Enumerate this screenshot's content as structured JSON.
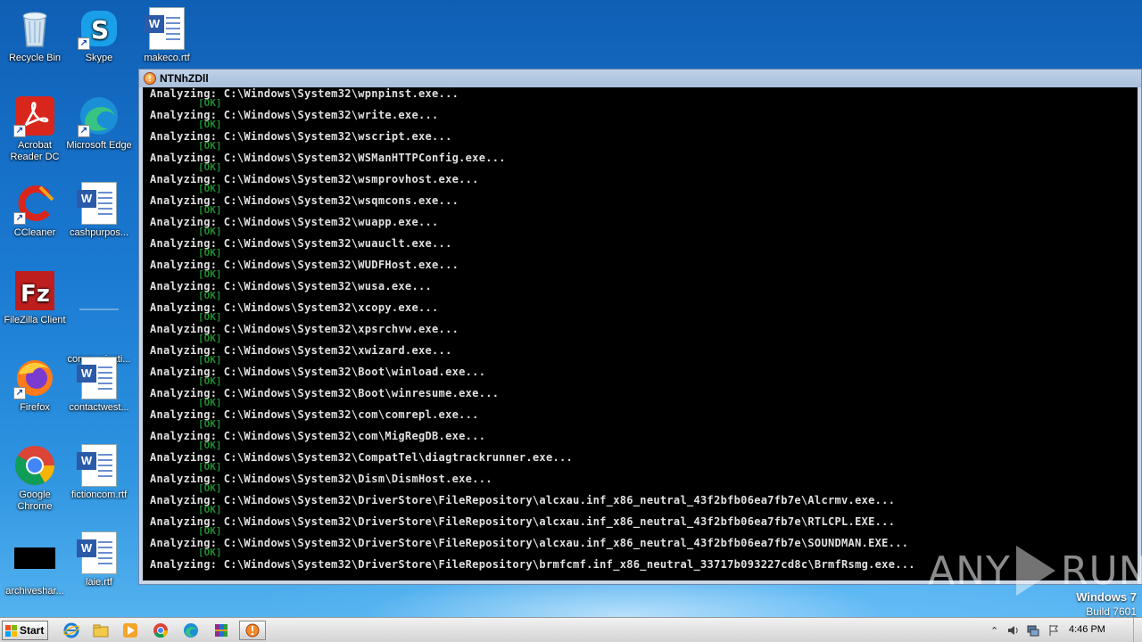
{
  "desktop": {
    "icons": [
      {
        "label": "Recycle Bin",
        "icon": "recycle-bin-icon"
      },
      {
        "label": "Skype",
        "icon": "skype-icon"
      },
      {
        "label": "makeco.rtf",
        "icon": "word-document-icon"
      },
      {
        "label": "Acrobat Reader DC",
        "icon": "acrobat-icon"
      },
      {
        "label": "Microsoft Edge",
        "icon": "edge-icon"
      },
      {
        "label": "CCleaner",
        "icon": "ccleaner-icon"
      },
      {
        "label": "cashpurpos...",
        "icon": "word-document-icon"
      },
      {
        "label": "FileZilla Client",
        "icon": "filezilla-icon"
      },
      {
        "label": "communicati...",
        "icon": "blank-file-icon"
      },
      {
        "label": "Firefox",
        "icon": "firefox-icon"
      },
      {
        "label": "contactwest...",
        "icon": "word-document-icon"
      },
      {
        "label": "Google Chrome",
        "icon": "chrome-icon"
      },
      {
        "label": "fictioncom.rtf",
        "icon": "word-document-icon"
      },
      {
        "label": "archiveshar...",
        "icon": "black-file-icon"
      },
      {
        "label": "laie.rtf",
        "icon": "word-document-icon"
      }
    ]
  },
  "console": {
    "title": "NTNhZDll",
    "ok_text": "[OK]",
    "lines": [
      "Analyzing: C:\\Windows\\System32\\wpnpinst.exe...",
      "Analyzing: C:\\Windows\\System32\\write.exe...",
      "Analyzing: C:\\Windows\\System32\\wscript.exe...",
      "Analyzing: C:\\Windows\\System32\\WSManHTTPConfig.exe...",
      "Analyzing: C:\\Windows\\System32\\wsmprovhost.exe...",
      "Analyzing: C:\\Windows\\System32\\wsqmcons.exe...",
      "Analyzing: C:\\Windows\\System32\\wuapp.exe...",
      "Analyzing: C:\\Windows\\System32\\wuauclt.exe...",
      "Analyzing: C:\\Windows\\System32\\WUDFHost.exe...",
      "Analyzing: C:\\Windows\\System32\\wusa.exe...",
      "Analyzing: C:\\Windows\\System32\\xcopy.exe...",
      "Analyzing: C:\\Windows\\System32\\xpsrchvw.exe...",
      "Analyzing: C:\\Windows\\System32\\xwizard.exe...",
      "Analyzing: C:\\Windows\\System32\\Boot\\winload.exe...",
      "Analyzing: C:\\Windows\\System32\\Boot\\winresume.exe...",
      "Analyzing: C:\\Windows\\System32\\com\\comrepl.exe...",
      "Analyzing: C:\\Windows\\System32\\com\\MigRegDB.exe...",
      "Analyzing: C:\\Windows\\System32\\CompatTel\\diagtrackrunner.exe...",
      "Analyzing: C:\\Windows\\System32\\Dism\\DismHost.exe...",
      "Analyzing: C:\\Windows\\System32\\DriverStore\\FileRepository\\alcxau.inf_x86_neutral_43f2bfb06ea7fb7e\\Alcrmv.exe...",
      "Analyzing: C:\\Windows\\System32\\DriverStore\\FileRepository\\alcxau.inf_x86_neutral_43f2bfb06ea7fb7e\\RTLCPL.EXE...",
      "Analyzing: C:\\Windows\\System32\\DriverStore\\FileRepository\\alcxau.inf_x86_neutral_43f2bfb06ea7fb7e\\SOUNDMAN.EXE...",
      "Analyzing: C:\\Windows\\System32\\DriverStore\\FileRepository\\brmfcmf.inf_x86_neutral_33717b093227cd8c\\BrmfRsmg.exe..."
    ]
  },
  "watermark": {
    "left": "ANY",
    "right": "RUN"
  },
  "os": {
    "name": "Windows 7",
    "build": "Build 7601"
  },
  "taskbar": {
    "start_label": "Start",
    "apps": [
      "internet-explorer-icon",
      "explorer-folder-icon",
      "media-player-icon",
      "chrome-icon",
      "edge-icon",
      "winrar-icon",
      "ntnhzdll-app-icon"
    ],
    "clock": "4:46 PM"
  }
}
